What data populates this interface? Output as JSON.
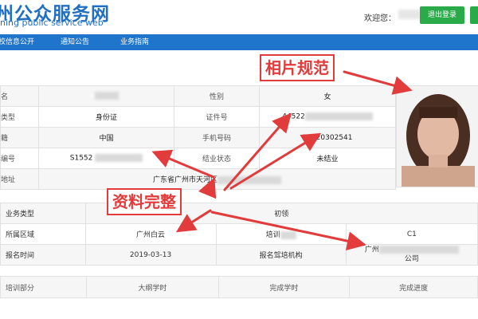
{
  "header": {
    "site_title": "州公众服务网",
    "site_subtitle": "ning public service web",
    "welcome_text": "欢迎您：",
    "logout_label": "退出登录"
  },
  "nav": {
    "items": [
      "校信息公开",
      "通知公告",
      "业务指南"
    ]
  },
  "personal": {
    "rows": [
      {
        "label1": "名",
        "value1": "",
        "label2": "性别",
        "value2": "女"
      },
      {
        "label1": "类型",
        "value1": "身份证",
        "label2": "证件号",
        "value2": "44522"
      },
      {
        "label1": "籍",
        "value1": "中国",
        "label2": "手机号码",
        "value2": "18020302541"
      },
      {
        "label1": "编号",
        "value1": "S1552",
        "label2": "结业状态",
        "value2": "未结业"
      },
      {
        "label1": "地址",
        "value1": "广东省广州市天河区"
      }
    ]
  },
  "business": {
    "rows": [
      {
        "label1": "业务类型",
        "value1": "初领"
      },
      {
        "label1": "所属区域",
        "value1": "广州白云",
        "label2": "培训",
        "value2": "C1"
      },
      {
        "label1": "报名时间",
        "value1": "2019-03-13",
        "label2": "报名驾培机构",
        "value2": "广州",
        "value2b": "公司"
      }
    ]
  },
  "training": {
    "headers": [
      "培训部分",
      "大纲学时",
      "完成学时",
      "完成进度"
    ]
  },
  "annotations": {
    "photo_label": "相片规范",
    "info_label": "资料完整",
    "color": "#e23b3b"
  }
}
